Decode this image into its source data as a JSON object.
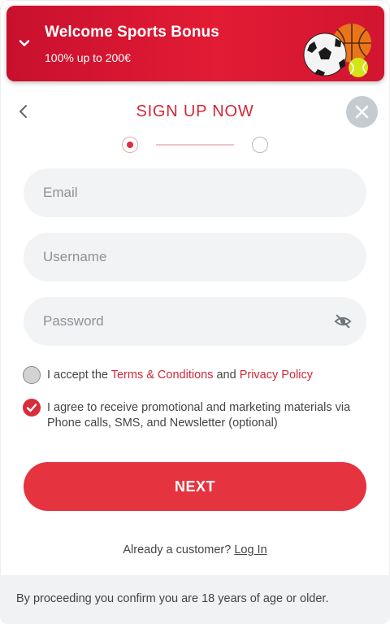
{
  "bonus": {
    "title": "Welcome Sports Bonus",
    "subtitle": "100% up to 200€"
  },
  "header": {
    "title": "SIGN UP NOW"
  },
  "stepper": {
    "current_step": 1,
    "total_steps": 2
  },
  "form": {
    "email_placeholder": "Email",
    "username_placeholder": "Username",
    "password_placeholder": "Password"
  },
  "terms": {
    "checked": false,
    "prefix": "I accept the ",
    "terms_link": "Terms & Conditions",
    "middle": " and ",
    "privacy_link": "Privacy Policy"
  },
  "marketing": {
    "checked": true,
    "text": "I agree to receive promotional and marketing materials via Phone calls, SMS, and Newsletter (optional)"
  },
  "next_label": "NEXT",
  "login": {
    "prompt": "Already a customer?",
    "link": "Log In"
  },
  "footer_text": "By proceeding you confirm you are 18 years of age or older.",
  "colors": {
    "brand_red": "#e31b34",
    "button_red": "#e53340",
    "link_red": "#d1283a",
    "close_grey": "#c4ccd2",
    "field_bg": "#f2f3f5"
  },
  "icons": [
    "chevron-down-icon",
    "sports-balls-icon",
    "chevron-left-icon",
    "close-icon",
    "eye-off-icon",
    "checkmark-icon"
  ]
}
